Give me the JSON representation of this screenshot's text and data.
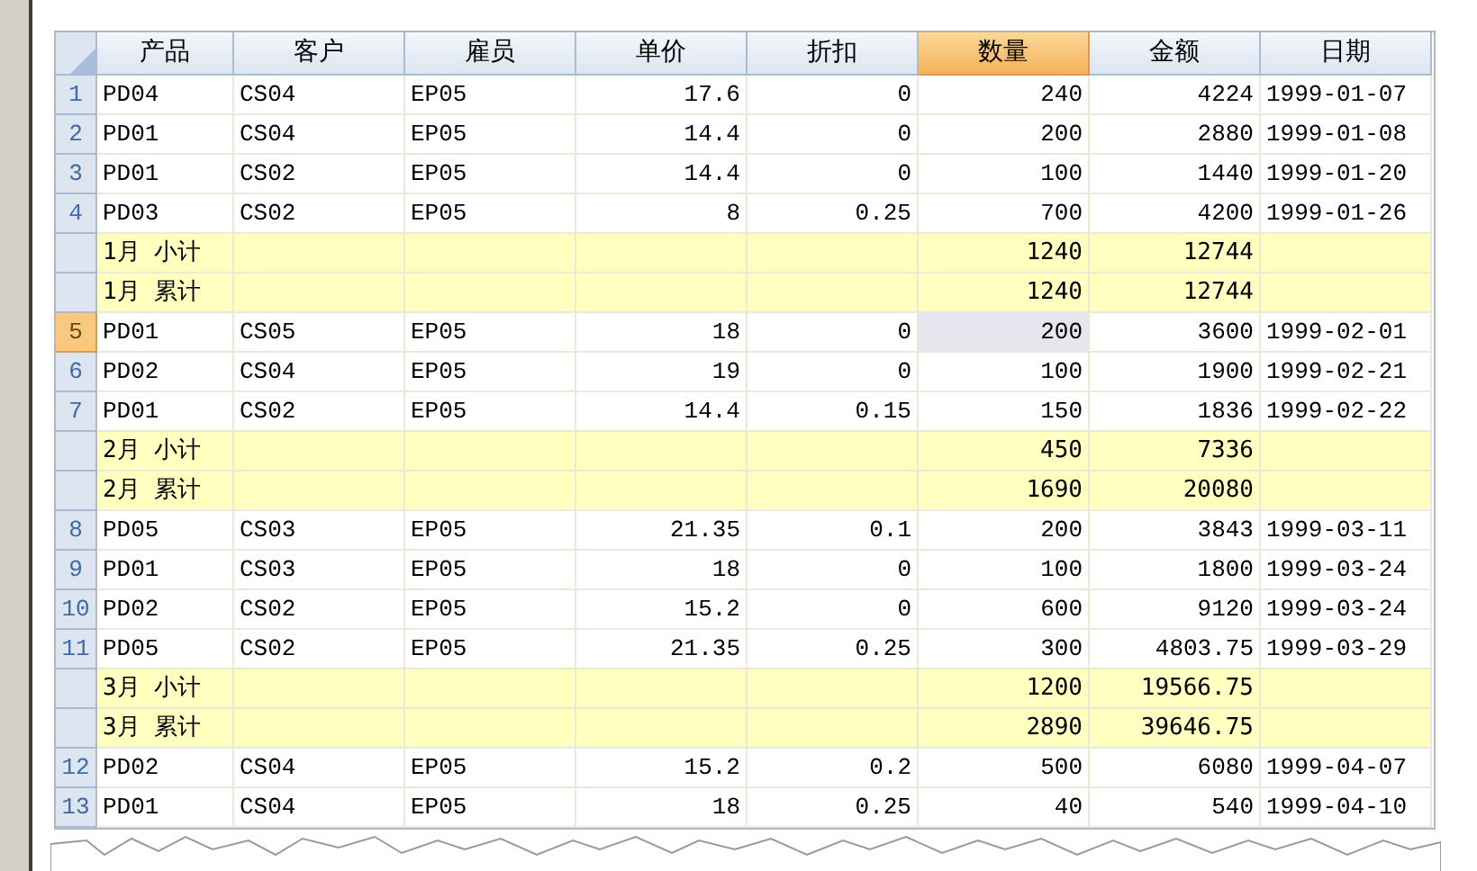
{
  "table": {
    "columns": [
      {
        "label": "产品",
        "selected": false
      },
      {
        "label": "客户",
        "selected": false
      },
      {
        "label": "雇员",
        "selected": false
      },
      {
        "label": "单价",
        "selected": false
      },
      {
        "label": "折扣",
        "selected": false
      },
      {
        "label": "数量",
        "selected": true
      },
      {
        "label": "金额",
        "selected": false
      },
      {
        "label": "日期",
        "selected": false
      }
    ],
    "rows": [
      {
        "kind": "data",
        "number": "1",
        "selected": false,
        "cells": [
          "PD04",
          "CS04",
          "EP05",
          "17.6",
          "0",
          "240",
          "4224",
          "1999-01-07"
        ]
      },
      {
        "kind": "data",
        "number": "2",
        "selected": false,
        "cells": [
          "PD01",
          "CS04",
          "EP05",
          "14.4",
          "0",
          "200",
          "2880",
          "1999-01-08"
        ]
      },
      {
        "kind": "data",
        "number": "3",
        "selected": false,
        "cells": [
          "PD01",
          "CS02",
          "EP05",
          "14.4",
          "0",
          "100",
          "1440",
          "1999-01-20"
        ]
      },
      {
        "kind": "data",
        "number": "4",
        "selected": false,
        "cells": [
          "PD03",
          "CS02",
          "EP05",
          "8",
          "0.25",
          "700",
          "4200",
          "1999-01-26"
        ]
      },
      {
        "kind": "summary",
        "label": "1月  小计",
        "quantity": "1240",
        "amount": "12744"
      },
      {
        "kind": "summary",
        "label": "1月  累计",
        "quantity": "1240",
        "amount": "12744"
      },
      {
        "kind": "data",
        "number": "5",
        "selected": true,
        "cells": [
          "PD01",
          "CS05",
          "EP05",
          "18",
          "0",
          "200",
          "3600",
          "1999-02-01"
        ]
      },
      {
        "kind": "data",
        "number": "6",
        "selected": false,
        "cells": [
          "PD02",
          "CS04",
          "EP05",
          "19",
          "0",
          "100",
          "1900",
          "1999-02-21"
        ]
      },
      {
        "kind": "data",
        "number": "7",
        "selected": false,
        "cells": [
          "PD01",
          "CS02",
          "EP05",
          "14.4",
          "0.15",
          "150",
          "1836",
          "1999-02-22"
        ]
      },
      {
        "kind": "summary",
        "label": "2月  小计",
        "quantity": "450",
        "amount": "7336"
      },
      {
        "kind": "summary",
        "label": "2月  累计",
        "quantity": "1690",
        "amount": "20080"
      },
      {
        "kind": "data",
        "number": "8",
        "selected": false,
        "cells": [
          "PD05",
          "CS03",
          "EP05",
          "21.35",
          "0.1",
          "200",
          "3843",
          "1999-03-11"
        ]
      },
      {
        "kind": "data",
        "number": "9",
        "selected": false,
        "cells": [
          "PD01",
          "CS03",
          "EP05",
          "18",
          "0",
          "100",
          "1800",
          "1999-03-24"
        ]
      },
      {
        "kind": "data",
        "number": "10",
        "selected": false,
        "cells": [
          "PD02",
          "CS02",
          "EP05",
          "15.2",
          "0",
          "600",
          "9120",
          "1999-03-24"
        ]
      },
      {
        "kind": "data",
        "number": "11",
        "selected": false,
        "cells": [
          "PD05",
          "CS02",
          "EP05",
          "21.35",
          "0.25",
          "300",
          "4803.75",
          "1999-03-29"
        ]
      },
      {
        "kind": "summary",
        "label": "3月  小计",
        "quantity": "1200",
        "amount": "19566.75"
      },
      {
        "kind": "summary",
        "label": "3月  累计",
        "quantity": "2890",
        "amount": "39646.75"
      },
      {
        "kind": "data",
        "number": "12",
        "selected": false,
        "cells": [
          "PD02",
          "CS04",
          "EP05",
          "15.2",
          "0.2",
          "500",
          "6080",
          "1999-04-07"
        ]
      },
      {
        "kind": "data",
        "number": "13",
        "selected": false,
        "cells": [
          "PD01",
          "CS04",
          "EP05",
          "18",
          "0.25",
          "40",
          "540",
          "1999-04-10"
        ]
      }
    ]
  }
}
